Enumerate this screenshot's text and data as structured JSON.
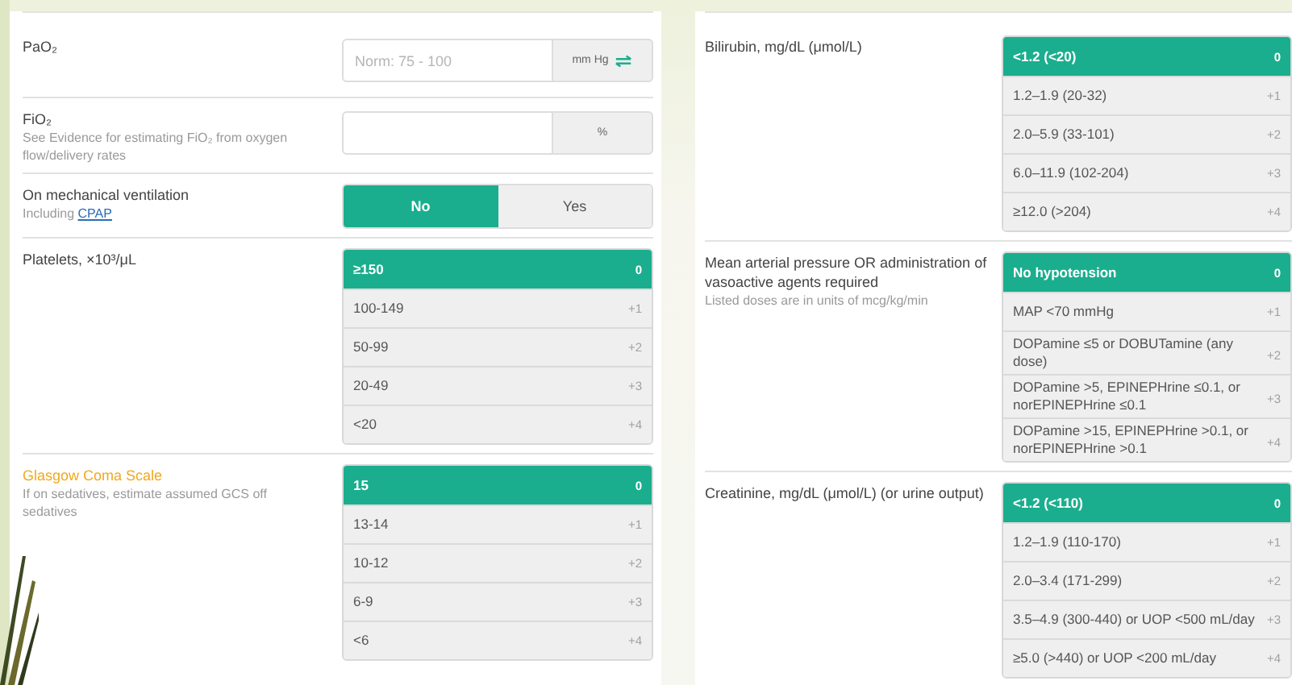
{
  "left_panel": {
    "fields": [
      {
        "kind": "number",
        "label": "PaO₂",
        "flagged": false,
        "placeholder": "Norm: 75 - 100",
        "unit": "mm Hg",
        "convertible": true
      },
      {
        "kind": "number",
        "label": "FiO₂",
        "flagged": false,
        "hint": "See Evidence for estimating FiO₂ from oxygen flow/delivery rates",
        "unit": "%",
        "convertible": false
      },
      {
        "kind": "toggle",
        "label": "On mechanical ventilation",
        "flagged": false,
        "hint": "Including",
        "hint_link": "CPAP",
        "options": [
          {
            "label": "No",
            "selected": true
          },
          {
            "label": "Yes",
            "selected": false
          }
        ]
      },
      {
        "kind": "options",
        "label": "Platelets, ×10³/μL",
        "flagged": false,
        "options": [
          {
            "label": "≥150",
            "points": "0",
            "selected": true
          },
          {
            "label": "100-149",
            "points": "+1",
            "selected": false
          },
          {
            "label": "50-99",
            "points": "+2",
            "selected": false
          },
          {
            "label": "20-49",
            "points": "+3",
            "selected": false
          },
          {
            "label": "<20",
            "points": "+4",
            "selected": false
          }
        ]
      },
      {
        "kind": "options",
        "label": "Glasgow Coma Scale",
        "flagged": true,
        "hint": "If on sedatives, estimate assumed GCS off sedatives",
        "options": [
          {
            "label": "15",
            "points": "0",
            "selected": true
          },
          {
            "label": "13-14",
            "points": "+1",
            "selected": false
          },
          {
            "label": "10-12",
            "points": "+2",
            "selected": false
          },
          {
            "label": "6-9",
            "points": "+3",
            "selected": false
          },
          {
            "label": "<6",
            "points": "+4",
            "selected": false
          }
        ]
      }
    ]
  },
  "right_panel": {
    "fields": [
      {
        "kind": "options",
        "label": "Bilirubin, mg/dL (μmol/L)",
        "flagged": false,
        "options": [
          {
            "label": "<1.2 (<20)",
            "points": "0",
            "selected": true
          },
          {
            "label": "1.2–1.9 (20-32)",
            "points": "+1",
            "selected": false
          },
          {
            "label": "2.0–5.9 (33-101)",
            "points": "+2",
            "selected": false
          },
          {
            "label": "6.0–11.9 (102-204)",
            "points": "+3",
            "selected": false
          },
          {
            "label": "≥12.0 (>204)",
            "points": "+4",
            "selected": false
          }
        ]
      },
      {
        "kind": "options",
        "label": "Mean arterial pressure OR administration of vasoactive agents required",
        "flagged": false,
        "hint": "Listed doses are in units of mcg/kg/min",
        "options": [
          {
            "label": "No hypotension",
            "points": "0",
            "selected": true
          },
          {
            "label": "MAP <70 mmHg",
            "points": "+1",
            "selected": false
          },
          {
            "label": "DOPamine ≤5 or DOBUTamine (any dose)",
            "points": "+2",
            "selected": false
          },
          {
            "label": "DOPamine >5, EPINEPHrine ≤0.1, or norEPINEPHrine ≤0.1",
            "points": "+3",
            "selected": false
          },
          {
            "label": "DOPamine >15, EPINEPHrine >0.1, or norEPINEPHrine >0.1",
            "points": "+4",
            "selected": false
          }
        ]
      },
      {
        "kind": "options",
        "label": "Creatinine, mg/dL (μmol/L) (or urine output)",
        "flagged": false,
        "options": [
          {
            "label": "<1.2 (<110)",
            "points": "0",
            "selected": true
          },
          {
            "label": "1.2–1.9 (110-170)",
            "points": "+1",
            "selected": false
          },
          {
            "label": "2.0–3.4 (171-299)",
            "points": "+2",
            "selected": false
          },
          {
            "label": "3.5–4.9 (300-440) or UOP <500 mL/day",
            "points": "+3",
            "selected": false
          },
          {
            "label": "≥5.0 (>440) or UOP <200 mL/day",
            "points": "+4",
            "selected": false
          }
        ]
      }
    ]
  }
}
